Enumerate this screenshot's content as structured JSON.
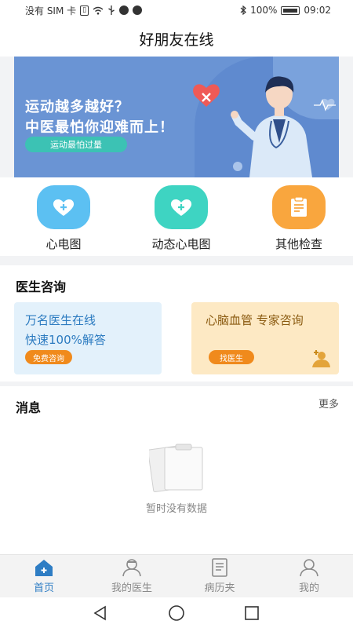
{
  "status": {
    "carrier": "没有 SIM 卡",
    "battery": "100%",
    "time": "09:02"
  },
  "header": {
    "title": "好朋友在线"
  },
  "banner": {
    "line1": "运动越多越好？",
    "line2": "中医最怕你迎难而上！",
    "pill": "运动最怕过量"
  },
  "menu": [
    {
      "label": "心电图",
      "icon": "heart-plus-icon",
      "color": "#5cc0f2"
    },
    {
      "label": "动态心电图",
      "icon": "heart-plus-icon",
      "color": "#3ed4c2"
    },
    {
      "label": "其他检查",
      "icon": "clipboard-icon",
      "color": "#f9a63e"
    }
  ],
  "consult": {
    "title": "医生咨询",
    "card1": {
      "line1": "万名医生在线",
      "line2": "快速100%解答",
      "button": "免费咨询"
    },
    "card2": {
      "line1": "心脑血管 专家咨询",
      "button": "找医生"
    }
  },
  "messages": {
    "title": "消息",
    "more": "更多",
    "empty": "暂时没有数据"
  },
  "tabs": [
    {
      "label": "首页",
      "icon": "home-icon",
      "active": true
    },
    {
      "label": "我的医生",
      "icon": "doctor-icon",
      "active": false
    },
    {
      "label": "病历夹",
      "icon": "document-icon",
      "active": false
    },
    {
      "label": "我的",
      "icon": "user-icon",
      "active": false
    }
  ],
  "colors": {
    "accent": "#2e7dc4",
    "inactive": "#8a8a8a"
  }
}
